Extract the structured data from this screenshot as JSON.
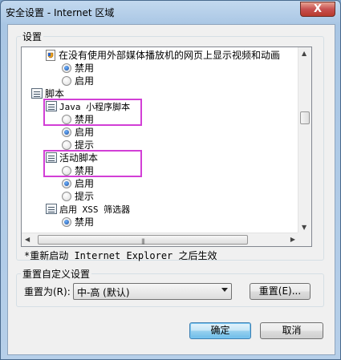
{
  "window": {
    "title": "安全设置 - Internet 区域",
    "close_glyph": "X"
  },
  "settings": {
    "group_label": "设置",
    "items": {
      "media_heading": "在没有使用外部媒体播放机的网页上显示视频和动画",
      "media_disable": "禁用",
      "media_enable": "启用",
      "scripting_heading": "脚本",
      "java_heading": "Java 小程序脚本",
      "java_disable": "禁用",
      "java_enable": "启用",
      "java_prompt": "提示",
      "active_heading": "活动脚本",
      "active_disable": "禁用",
      "active_enable": "启用",
      "active_prompt": "提示",
      "xss_heading": "启用 XSS 筛选器",
      "xss_disable": "禁用"
    },
    "selected": {
      "media": "disable",
      "java": "enable",
      "active": "enable",
      "xss": "disable"
    },
    "restart_note": "*重新启动 Internet Explorer 之后生效"
  },
  "reset": {
    "group_label": "重置自定义设置",
    "reset_to_label": "重置为(R):",
    "level_value": "中-高 (默认)",
    "reset_button": "重置(E)..."
  },
  "footer": {
    "ok_button": "确定",
    "cancel_button": "取消"
  },
  "colors": {
    "highlight_box": "#d23fd6",
    "radio_selected": "#1a4c9c",
    "close_button": "#c75050"
  }
}
